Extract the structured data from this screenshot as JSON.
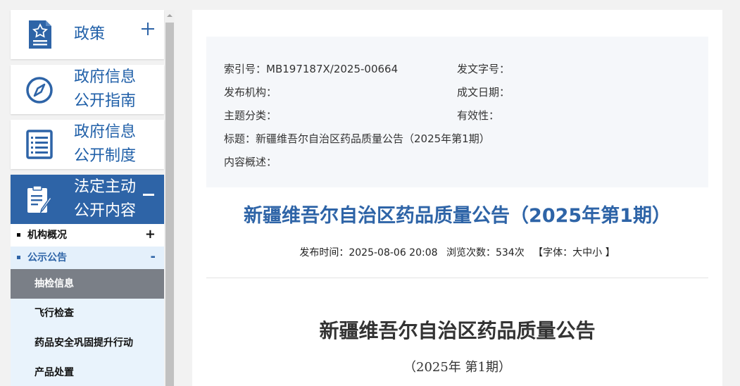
{
  "sidebar": {
    "menu": [
      {
        "line1": "政策",
        "line2": "",
        "icon": "policy-doc-icon",
        "expanded": false
      },
      {
        "line1": "政府信息",
        "line2": "公开指南",
        "icon": "compass-icon",
        "expanded": false
      },
      {
        "line1": "政府信息",
        "line2": "公开制度",
        "icon": "list-doc-icon",
        "expanded": false
      },
      {
        "line1": "法定主动",
        "line2": "公开内容",
        "icon": "clipboard-pen-icon",
        "expanded": true
      }
    ],
    "subsections": [
      {
        "label": "机构概况",
        "sign": "+"
      },
      {
        "label": "公示公告",
        "sign": "-"
      }
    ],
    "leaves": [
      "抽检信息",
      "飞行检查",
      "药品安全巩固提升行动",
      "产品处置"
    ],
    "selected_leaf": "抽检信息"
  },
  "meta": {
    "index_label": "索引号：MB197187X/2025-00664",
    "doc_no_label": "发文字号：",
    "publisher_label": "发布机构：",
    "date_label": "成文日期：",
    "topic_label": "主题分类：",
    "validity_label": "有效性：",
    "title_label": "标题：新疆维吾尔自治区药品质量公告（2025年第1期）",
    "summary_label": "内容概述："
  },
  "article": {
    "title": "新疆维吾尔自治区药品质量公告（2025年第1期）",
    "publish_time": "发布时间：2025-08-06 20:08",
    "views": "浏览次数：534次",
    "font_size": "【字体：大中小 】",
    "doc_title": "新疆维吾尔自治区药品质量公告",
    "doc_issue": "（2025年 第1期）"
  },
  "colors": {
    "accent": "#2e64a7",
    "selected_leaf_bg": "#7a7f87",
    "submenu_bg": "#e9f3fc"
  }
}
